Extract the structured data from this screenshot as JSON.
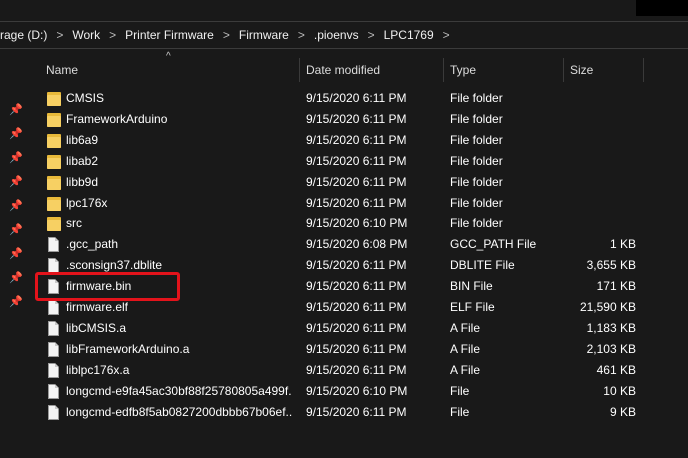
{
  "breadcrumb": [
    {
      "label": "rage (D:)"
    },
    {
      "label": "Work"
    },
    {
      "label": "Printer Firmware"
    },
    {
      "label": "Firmware"
    },
    {
      "label": ".pioenvs"
    },
    {
      "label": "LPC1769"
    }
  ],
  "breadcrumb_separator": ">",
  "columns": {
    "name": "Name",
    "date": "Date modified",
    "type": "Type",
    "size": "Size"
  },
  "files": [
    {
      "name": "CMSIS",
      "date": "9/15/2020 6:11 PM",
      "type": "File folder",
      "size": "",
      "icon": "folder-icon"
    },
    {
      "name": "FrameworkArduino",
      "date": "9/15/2020 6:11 PM",
      "type": "File folder",
      "size": "",
      "icon": "folder-icon"
    },
    {
      "name": "lib6a9",
      "date": "9/15/2020 6:11 PM",
      "type": "File folder",
      "size": "",
      "icon": "folder-icon"
    },
    {
      "name": "libab2",
      "date": "9/15/2020 6:11 PM",
      "type": "File folder",
      "size": "",
      "icon": "folder-icon"
    },
    {
      "name": "libb9d",
      "date": "9/15/2020 6:11 PM",
      "type": "File folder",
      "size": "",
      "icon": "folder-icon"
    },
    {
      "name": "lpc176x",
      "date": "9/15/2020 6:11 PM",
      "type": "File folder",
      "size": "",
      "icon": "folder-icon"
    },
    {
      "name": "src",
      "date": "9/15/2020 6:10 PM",
      "type": "File folder",
      "size": "",
      "icon": "folder-icon"
    },
    {
      "name": ".gcc_path",
      "date": "9/15/2020 6:08 PM",
      "type": "GCC_PATH File",
      "size": "1 KB",
      "icon": "file-icon"
    },
    {
      "name": ".sconsign37.dblite",
      "date": "9/15/2020 6:11 PM",
      "type": "DBLITE File",
      "size": "3,655 KB",
      "icon": "file-icon"
    },
    {
      "name": "firmware.bin",
      "date": "9/15/2020 6:11 PM",
      "type": "BIN File",
      "size": "171 KB",
      "icon": "file-icon"
    },
    {
      "name": "firmware.elf",
      "date": "9/15/2020 6:11 PM",
      "type": "ELF File",
      "size": "21,590 KB",
      "icon": "file-icon"
    },
    {
      "name": "libCMSIS.a",
      "date": "9/15/2020 6:11 PM",
      "type": "A File",
      "size": "1,183 KB",
      "icon": "file-icon"
    },
    {
      "name": "libFrameworkArduino.a",
      "date": "9/15/2020 6:11 PM",
      "type": "A File",
      "size": "2,103 KB",
      "icon": "file-icon"
    },
    {
      "name": "liblpc176x.a",
      "date": "9/15/2020 6:11 PM",
      "type": "A File",
      "size": "461 KB",
      "icon": "file-icon"
    },
    {
      "name": "longcmd-e9fa45ac30bf88f25780805a499f...",
      "date": "9/15/2020 6:10 PM",
      "type": "File",
      "size": "10 KB",
      "icon": "file-icon"
    },
    {
      "name": "longcmd-edfb8f5ab0827200dbbb67b06ef...",
      "date": "9/15/2020 6:11 PM",
      "type": "File",
      "size": "9 KB",
      "icon": "file-icon"
    }
  ],
  "highlighted_file": "firmware.bin",
  "colors": {
    "background": "#191919",
    "highlight": "#e3131b",
    "folder": "#f7d063"
  }
}
